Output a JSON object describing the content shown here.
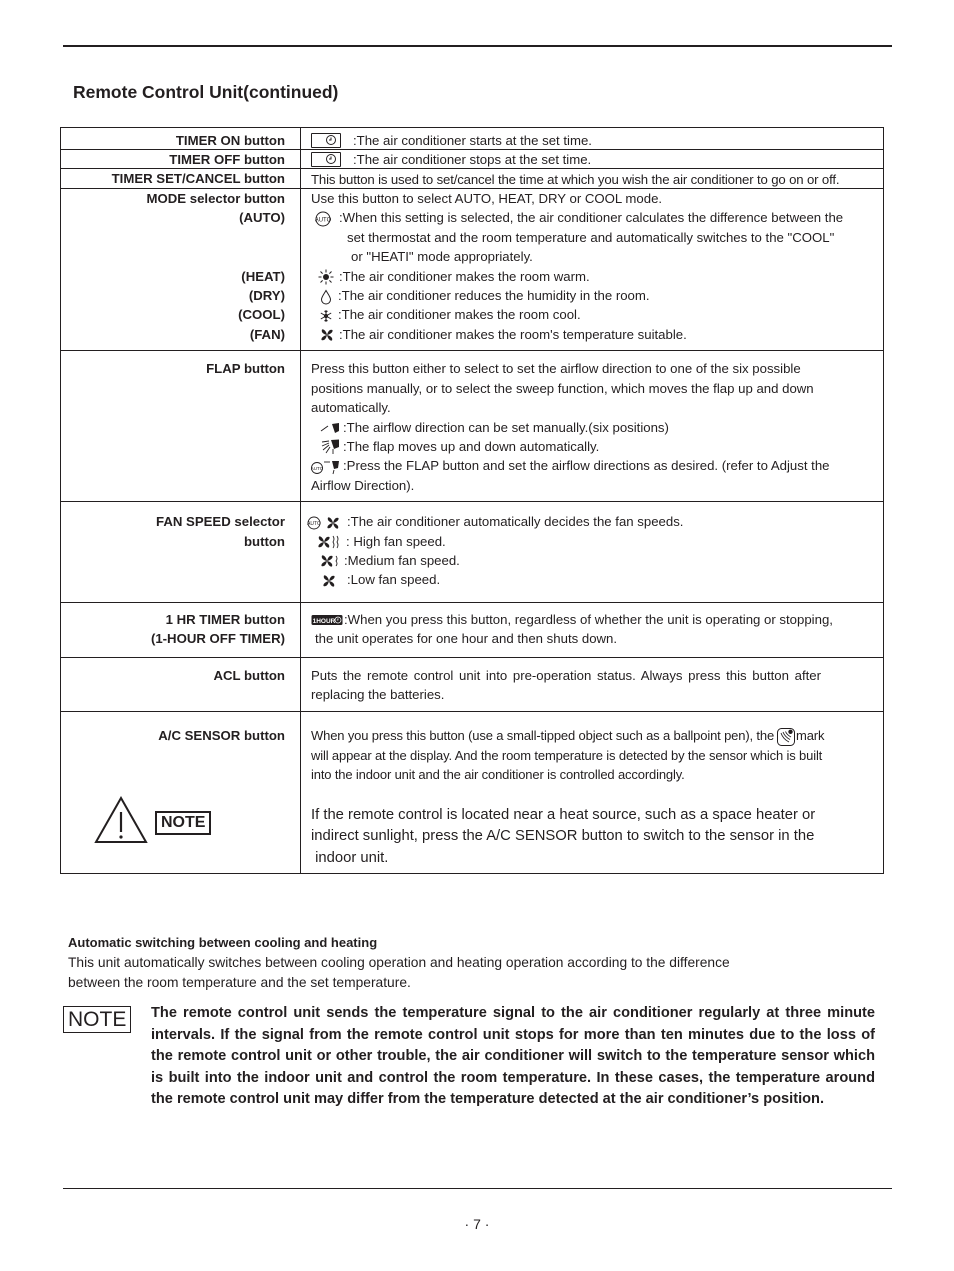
{
  "page": {
    "section_title": "Remote Control Unit(continued)",
    "page_number": "· 7 ·"
  },
  "table": {
    "timer_on": {
      "label": "TIMER ON button",
      "icon": "timer-clock-icon",
      "text": ":The air conditioner starts at the set time."
    },
    "timer_off": {
      "label": "TIMER OFF button",
      "icon": "timer-clock-icon",
      "text": ":The air conditioner stops at the set time."
    },
    "timer_set": {
      "label": "TIMER SET/CANCEL button",
      "text": "This button is used to set/cancel the time at which you wish the air conditioner to go on or off."
    },
    "mode": {
      "label": "MODE selector button",
      "intro": "Use this button to select AUTO, HEAT, DRY or COOL mode.",
      "auto_label": "(AUTO)",
      "auto_icon": "auto-mode-icon",
      "auto_lines": [
        ":When this setting is selected, the air conditioner calculates the difference between the",
        "set thermostat and the room temperature and automatically switches to the \"COOL\"",
        "or \"HEATI\" mode appropriately."
      ],
      "items": [
        {
          "label": "(HEAT)",
          "icon": "sun-heat-icon",
          "text": ":The air conditioner makes the room warm."
        },
        {
          "label": "(DRY)",
          "icon": "water-drop-icon",
          "text": ":The air conditioner reduces the humidity in the room."
        },
        {
          "label": "(COOL)",
          "icon": "snowflake-icon",
          "text": ":The air conditioner makes the room cool."
        },
        {
          "label": "(FAN)",
          "icon": "fan-icon",
          "text": ":The air conditioner makes the room's temperature suitable."
        }
      ]
    },
    "flap": {
      "label": "FLAP button",
      "intro_lines": [
        "Press  this  button  either to select   to  set the  airflow  direction to one of the six possible",
        "positions  manually,  or  to  select  the   sweep function, which moves the flap up and down",
        "automatically."
      ],
      "items": [
        {
          "icon": "flap-manual-icon",
          "text": ":The airflow direction can be set manually.(six positions)"
        },
        {
          "icon": "flap-swing-icon",
          "text": ":The flap moves up and down automatically."
        },
        {
          "icon": "flap-auto-icon",
          "text": ":Press the FLAP button and set the  airflow directions  as  desired. (refer to Adjust the"
        }
      ],
      "tail": "Airflow Direction)."
    },
    "fan_speed": {
      "label_lines": [
        "FAN SPEED selector",
        "button"
      ],
      "items": [
        {
          "icon": "fan-auto-icon",
          "text": ":The air conditioner automatically decides  the fan speeds."
        },
        {
          "icon": "fan-high-icon",
          "text": ": High fan speed."
        },
        {
          "icon": "fan-medium-icon",
          "text": ":Medium fan speed."
        },
        {
          "icon": "fan-low-icon",
          "text": ":Low fan speed."
        }
      ]
    },
    "one_hr": {
      "label_lines": [
        "1 HR TIMER button",
        "(1-HOUR OFF TIMER)"
      ],
      "icon": "one-hour-timer-icon",
      "icon_text": "1HOUR",
      "lines": [
        ":When you press this button, regardless of whether the unit is operating or stopping,",
        "the unit operates for one hour and then shuts down."
      ]
    },
    "acl": {
      "label": "ACL button",
      "lines": [
        "Puts  the  remote  control  unit  into  pre-operation  status.  Always  press  this  button  after",
        "replacing  the batteries."
      ]
    },
    "ac_sensor": {
      "label": "A/C SENSOR button",
      "line1_before": "When you press this button (use a small-tipped object such as a ballpoint pen), the",
      "line1_icon": "sensor-mark-icon",
      "line1_after": "mark",
      "lines": [
        "will appear at the display. And the room temperature is detected by the sensor which is built",
        "into the indoor unit and the air conditioner is controlled accordingly."
      ],
      "note_label": "NOTE",
      "note_lines": [
        "If the remote control is located near a heat source, such as a space heater or",
        "indirect sunlight, press the A/C SENSOR button to switch to the sensor in the",
        " indoor unit."
      ]
    }
  },
  "auto_switching": {
    "heading": "Automatic switching between cooling and heating",
    "lines": [
      "This unit  automatically switches between cooling operation and heating operation according to the difference",
      "between the room temperature and the set temperature."
    ]
  },
  "note": {
    "label": "NOTE",
    "text": "The remote control unit sends the temperature signal to the air conditioner regularly at three minute intervals. If the signal from the remote control unit stops for more than ten minutes due to the loss of the remote control unit or other trouble, the air conditioner will switch to the temperature sensor which is built into the indoor unit and control the room temperature. In these cases, the temperature around the remote control unit may differ from the temperature detected at  the air conditioner’s position."
  }
}
